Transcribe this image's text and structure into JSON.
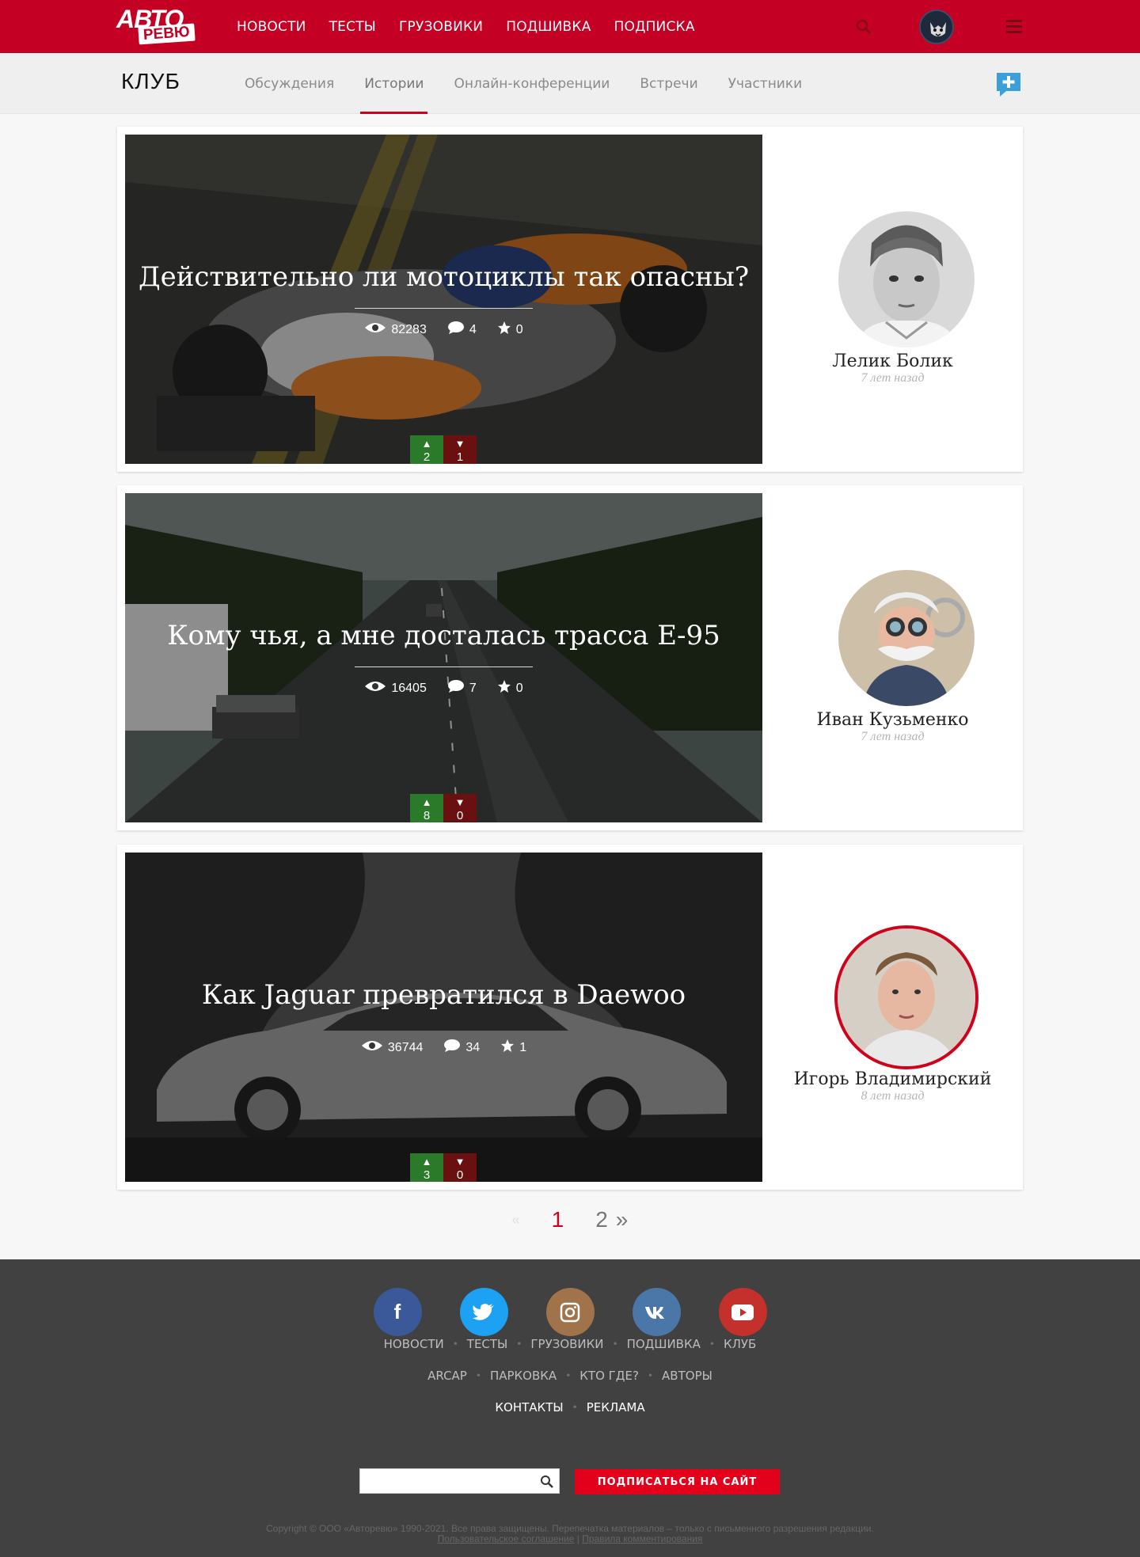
{
  "header": {
    "logo_line1": "АВТО",
    "logo_line2": "РЕВЮ",
    "nav": [
      "НОВОСТИ",
      "ТЕСТЫ",
      "ГРУЗОВИКИ",
      "ПОДШИВКА",
      "ПОДПИСКА"
    ]
  },
  "subheader": {
    "title": "КЛУБ",
    "tabs": [
      "Обсуждения",
      "Истории",
      "Онлайн-конференции",
      "Встречи",
      "Участники"
    ],
    "active_tab": "Истории"
  },
  "stories": [
    {
      "title": "Действительно ли мотоциклы так опасны?",
      "views": "82283",
      "comments": "4",
      "favorites": "0",
      "votes_up": "2",
      "votes_down": "1",
      "author": "Лелик Болик",
      "time": "7 лет назад"
    },
    {
      "title": "Кому чья, а мне досталась трасса Е-95",
      "views": "16405",
      "comments": "7",
      "favorites": "0",
      "votes_up": "8",
      "votes_down": "0",
      "author": "Иван Кузьменко",
      "time": "7 лет назад"
    },
    {
      "title": "Как Jaguar превратился в Daewoo",
      "views": "36744",
      "comments": "34",
      "favorites": "1",
      "votes_up": "3",
      "votes_down": "0",
      "author": "Игорь Владимирский",
      "time": "8 лет назад"
    }
  ],
  "pagination": {
    "prev": "«",
    "current": "1",
    "next_page": "2",
    "next": "»"
  },
  "footer": {
    "socials": [
      "facebook",
      "twitter",
      "instagram",
      "vk",
      "youtube"
    ],
    "links_row1": [
      "НОВОСТИ",
      "ТЕСТЫ",
      "ГРУЗОВИКИ",
      "ПОДШИВКА",
      "КЛУБ"
    ],
    "links_row2": [
      "ARCAP",
      "ПАРКОВКА",
      "КТО ГДЕ?",
      "АВТОРЫ"
    ],
    "links_row3": [
      "КОНТАКТЫ",
      "РЕКЛАМА"
    ],
    "search_placeholder": "",
    "subscribe_label": "ПОДПИСАТЬСЯ НА САЙТ",
    "copyright": "Copyright © ООО «Авторевю» 1990-2021. Все права защищены. Перепечатка материалов – только с письменного разрешения редакции.",
    "link_terms": "Пользовательское соглашение",
    "link_sep": "|",
    "link_rules": "Правила комментирования"
  },
  "colors": {
    "brand_red": "#c40024",
    "vote_up": "#2a7a2a",
    "vote_down": "#6a1010",
    "footer_bg": "#414141"
  }
}
